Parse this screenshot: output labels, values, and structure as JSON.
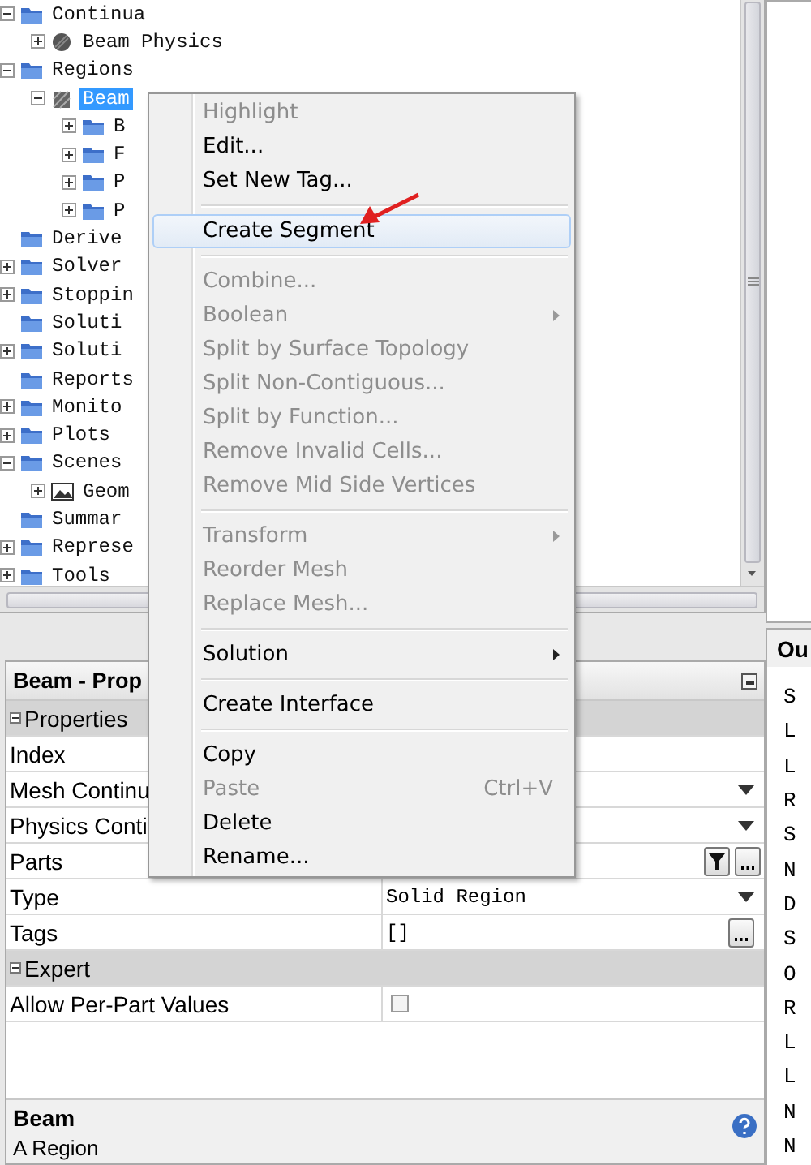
{
  "tree": {
    "items": [
      {
        "label": "Continua",
        "kind": "folder",
        "expanded": true,
        "selected": false,
        "children": [
          {
            "label": "Beam Physics",
            "kind": "physics",
            "expanded": false,
            "selected": false
          }
        ]
      },
      {
        "label": "Regions",
        "kind": "folder",
        "expanded": true,
        "selected": false,
        "children": [
          {
            "label": "Beam",
            "kind": "region",
            "expanded": true,
            "selected": true,
            "children": [
              {
                "label": "B",
                "kind": "folder",
                "expanded": false,
                "selected": false
              },
              {
                "label": "F",
                "kind": "folder",
                "expanded": false,
                "selected": false
              },
              {
                "label": "P",
                "kind": "folder",
                "expanded": false,
                "selected": false
              },
              {
                "label": "P",
                "kind": "folder",
                "expanded": false,
                "selected": false
              }
            ]
          }
        ]
      },
      {
        "label": "Derive",
        "kind": "folder",
        "selected": false
      },
      {
        "label": "Solver",
        "kind": "folder",
        "expanded": false,
        "selected": false
      },
      {
        "label": "Stoppin",
        "kind": "folder",
        "expanded": false,
        "selected": false
      },
      {
        "label": "Soluti",
        "kind": "folder",
        "selected": false
      },
      {
        "label": "Soluti",
        "kind": "folder",
        "expanded": false,
        "selected": false
      },
      {
        "label": "Reports",
        "kind": "folder",
        "selected": false
      },
      {
        "label": "Monito",
        "kind": "folder",
        "expanded": false,
        "selected": false
      },
      {
        "label": "Plots",
        "kind": "folder",
        "expanded": false,
        "selected": false
      },
      {
        "label": "Scenes",
        "kind": "folder",
        "expanded": true,
        "selected": false,
        "children": [
          {
            "label": "Geom",
            "kind": "scene",
            "expanded": false,
            "selected": false
          }
        ]
      },
      {
        "label": "Summar",
        "kind": "folder",
        "selected": false
      },
      {
        "label": "Represe",
        "kind": "folder",
        "expanded": false,
        "selected": false
      },
      {
        "label": "Tools",
        "kind": "folder",
        "expanded": false,
        "selected": false
      }
    ]
  },
  "properties": {
    "title": "Beam - Prop",
    "rows": [
      {
        "kind": "section",
        "label": "Properties",
        "expanded": true
      },
      {
        "kind": "text",
        "label": "Index"
      },
      {
        "kind": "dropdown",
        "label": "Mesh Continu"
      },
      {
        "kind": "dropdown",
        "label": "Physics Conti"
      },
      {
        "kind": "parts",
        "label": "Parts"
      },
      {
        "kind": "dropdown",
        "label": "Type",
        "value": "Solid Region"
      },
      {
        "kind": "ellipsis",
        "label": "Tags",
        "value": "[]"
      },
      {
        "kind": "section",
        "label": "Expert",
        "expanded": true
      },
      {
        "kind": "checkbox",
        "label": "Allow Per-Part Values",
        "checked": false
      }
    ],
    "footer": {
      "title": "Beam",
      "description": "A Region"
    }
  },
  "output": {
    "title": "Ou",
    "lines": [
      "S",
      "L",
      "L",
      "R",
      "S",
      "N",
      "D",
      "S",
      "O",
      "R",
      "L",
      "L",
      "N",
      "N"
    ]
  },
  "context_menu": {
    "items": [
      {
        "kind": "item",
        "label": "Highlight",
        "disabled": true,
        "selected": false
      },
      {
        "kind": "item",
        "label": "Edit...",
        "disabled": false,
        "selected": false
      },
      {
        "kind": "item",
        "label": "Set New Tag...",
        "disabled": false,
        "selected": false
      },
      {
        "kind": "separator"
      },
      {
        "kind": "item",
        "label": "Create Segment",
        "disabled": false,
        "selected": true
      },
      {
        "kind": "separator"
      },
      {
        "kind": "item",
        "label": "Combine...",
        "disabled": true,
        "selected": false
      },
      {
        "kind": "item",
        "label": "Boolean",
        "disabled": true,
        "selected": false,
        "submenu": true
      },
      {
        "kind": "item",
        "label": "Split by Surface Topology",
        "disabled": true,
        "selected": false
      },
      {
        "kind": "item",
        "label": "Split Non-Contiguous...",
        "disabled": true,
        "selected": false
      },
      {
        "kind": "item",
        "label": "Split by Function...",
        "disabled": true,
        "selected": false
      },
      {
        "kind": "item",
        "label": "Remove Invalid Cells...",
        "disabled": true,
        "selected": false
      },
      {
        "kind": "item",
        "label": "Remove Mid Side Vertices",
        "disabled": true,
        "selected": false
      },
      {
        "kind": "separator"
      },
      {
        "kind": "item",
        "label": "Transform",
        "disabled": true,
        "selected": false,
        "submenu": true
      },
      {
        "kind": "item",
        "label": "Reorder Mesh",
        "disabled": true,
        "selected": false
      },
      {
        "kind": "item",
        "label": "Replace Mesh...",
        "disabled": true,
        "selected": false
      },
      {
        "kind": "separator"
      },
      {
        "kind": "item",
        "label": "Solution",
        "disabled": false,
        "selected": false,
        "submenu": true
      },
      {
        "kind": "separator"
      },
      {
        "kind": "item",
        "label": "Create Interface",
        "disabled": false,
        "selected": false
      },
      {
        "kind": "separator"
      },
      {
        "kind": "item",
        "label": "Copy",
        "disabled": false,
        "selected": false
      },
      {
        "kind": "item",
        "label": "Paste",
        "disabled": true,
        "selected": false,
        "shortcut": "Ctrl+V"
      },
      {
        "kind": "item",
        "label": "Delete",
        "disabled": false,
        "selected": false
      },
      {
        "kind": "item",
        "label": "Rename...",
        "disabled": false,
        "selected": false
      }
    ]
  }
}
